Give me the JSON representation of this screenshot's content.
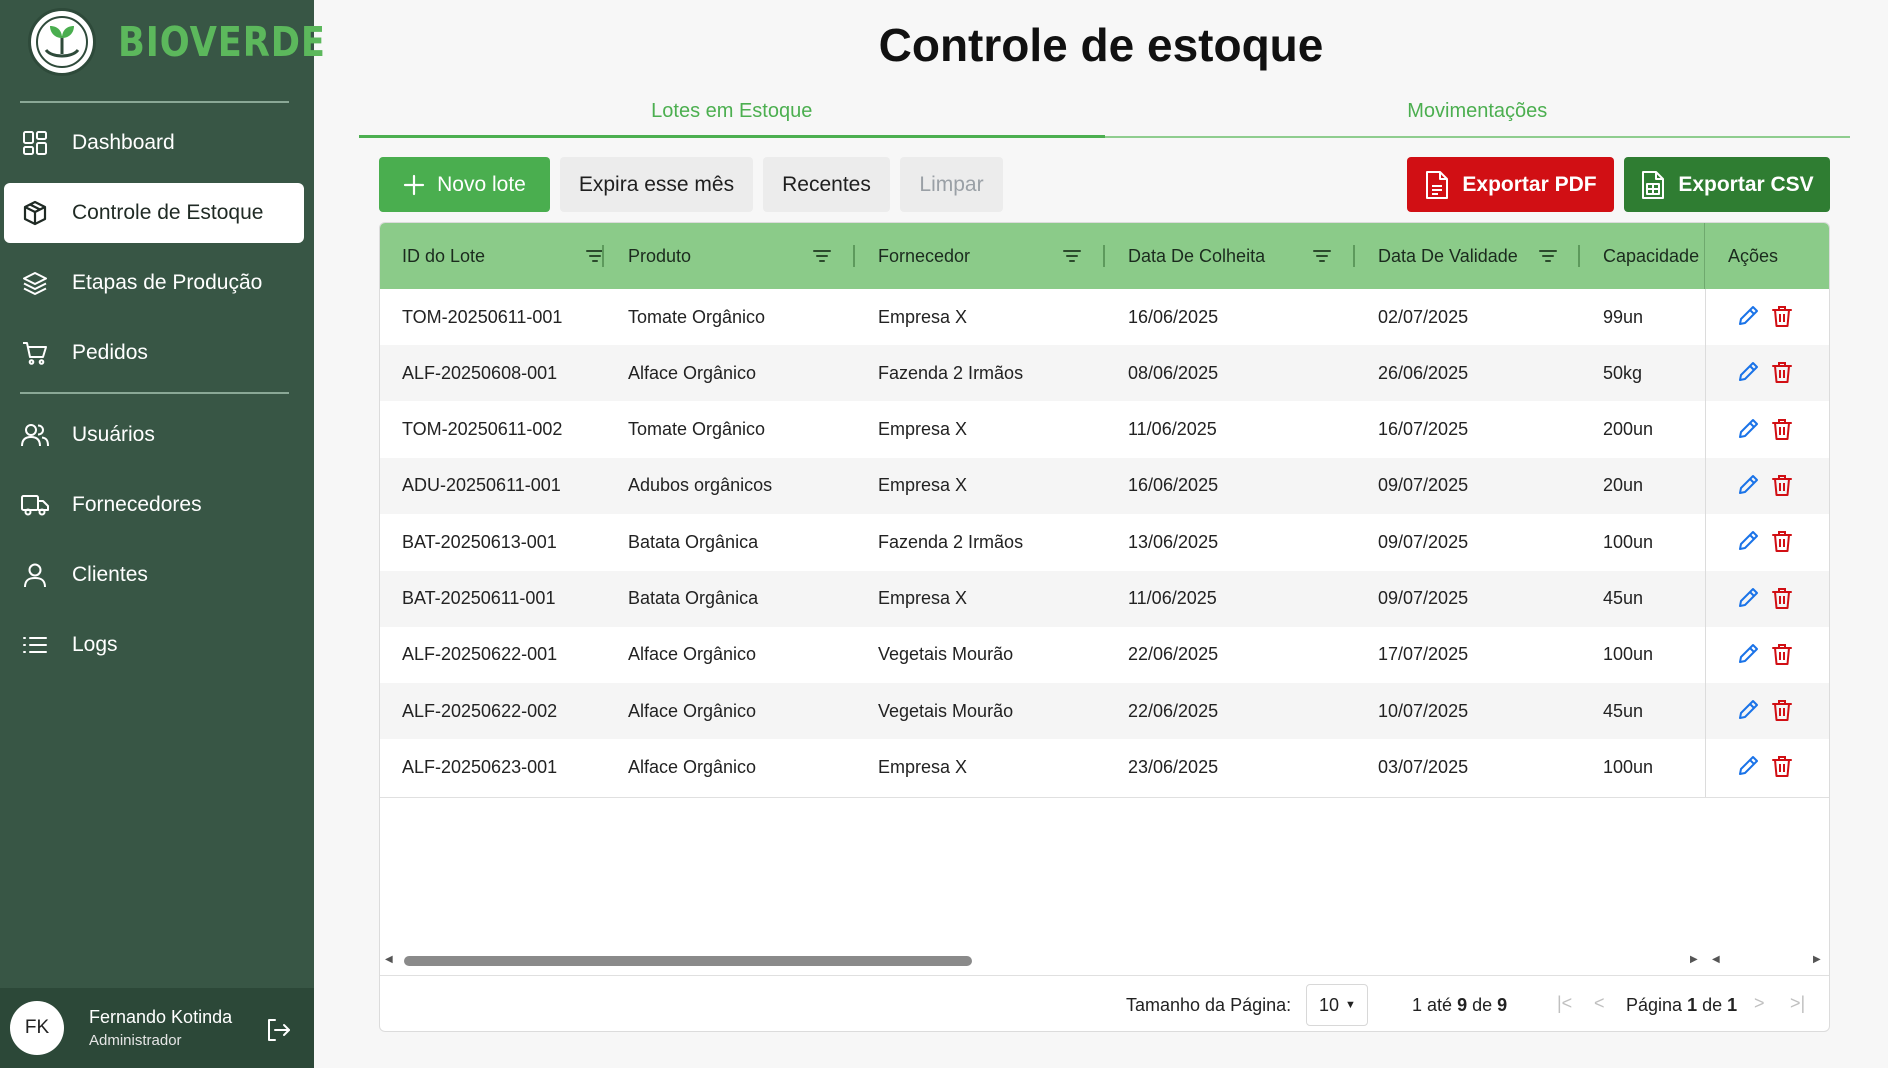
{
  "brand": {
    "name": "BIOVERDE"
  },
  "sidebar": {
    "items": [
      {
        "label": "Dashboard",
        "icon": "dashboard-icon"
      },
      {
        "label": "Controle de Estoque",
        "icon": "box-icon",
        "active": true
      },
      {
        "label": "Etapas de Produção",
        "icon": "layers-icon"
      },
      {
        "label": "Pedidos",
        "icon": "cart-icon"
      },
      {
        "label": "Usuários",
        "icon": "users-icon"
      },
      {
        "label": "Fornecedores",
        "icon": "truck-icon"
      },
      {
        "label": "Clientes",
        "icon": "user-icon"
      },
      {
        "label": "Logs",
        "icon": "list-icon"
      }
    ]
  },
  "user": {
    "initials": "FK",
    "name": "Fernando Kotinda",
    "role": "Administrador"
  },
  "page": {
    "title": "Controle de estoque"
  },
  "tabs": [
    {
      "label": "Lotes em Estoque",
      "active": true
    },
    {
      "label": "Movimentações",
      "active": false
    }
  ],
  "toolbar": {
    "new_lot": "Novo lote",
    "expires": "Expira esse mês",
    "recent": "Recentes",
    "clear": "Limpar",
    "export_pdf": "Exportar PDF",
    "export_csv": "Exportar CSV"
  },
  "table": {
    "columns": [
      "ID do Lote",
      "Produto",
      "Fornecedor",
      "Data De Colheita",
      "Data De Validade",
      "Capacidade",
      "Ações"
    ],
    "rows": [
      [
        "TOM-20250611-001",
        "Tomate Orgânico",
        "Empresa X",
        "16/06/2025",
        "02/07/2025",
        "99un"
      ],
      [
        "ALF-20250608-001",
        "Alface Orgânico",
        "Fazenda 2 Irmãos",
        "08/06/2025",
        "26/06/2025",
        "50kg"
      ],
      [
        "TOM-20250611-002",
        "Tomate Orgânico",
        "Empresa X",
        "11/06/2025",
        "16/07/2025",
        "200un"
      ],
      [
        "ADU-20250611-001",
        "Adubos orgânicos",
        "Empresa X",
        "16/06/2025",
        "09/07/2025",
        "20un"
      ],
      [
        "BAT-20250613-001",
        "Batata Orgânica",
        "Fazenda 2 Irmãos",
        "13/06/2025",
        "09/07/2025",
        "100un"
      ],
      [
        "BAT-20250611-001",
        "Batata Orgânica",
        "Empresa X",
        "11/06/2025",
        "09/07/2025",
        "45un"
      ],
      [
        "ALF-20250622-001",
        "Alface Orgânico",
        "Vegetais Mourão",
        "22/06/2025",
        "17/07/2025",
        "100un"
      ],
      [
        "ALF-20250622-002",
        "Alface Orgânico",
        "Vegetais Mourão",
        "22/06/2025",
        "10/07/2025",
        "45un"
      ],
      [
        "ALF-20250623-001",
        "Alface Orgânico",
        "Empresa X",
        "23/06/2025",
        "03/07/2025",
        "100un"
      ]
    ]
  },
  "pager": {
    "size_label": "Tamanho da Página:",
    "size_value": "10",
    "range_from": "1",
    "range_to": "9",
    "range_total": "9",
    "range_text_1": "até",
    "range_text_2": "de",
    "page_label": "Página",
    "page_current": "1",
    "page_of": "de",
    "page_total": "1"
  },
  "colors": {
    "sidebar": "#385645",
    "accent": "#4aae4f",
    "header": "#8bcb89",
    "danger": "#d10f14",
    "dark_green": "#2f7d32"
  }
}
